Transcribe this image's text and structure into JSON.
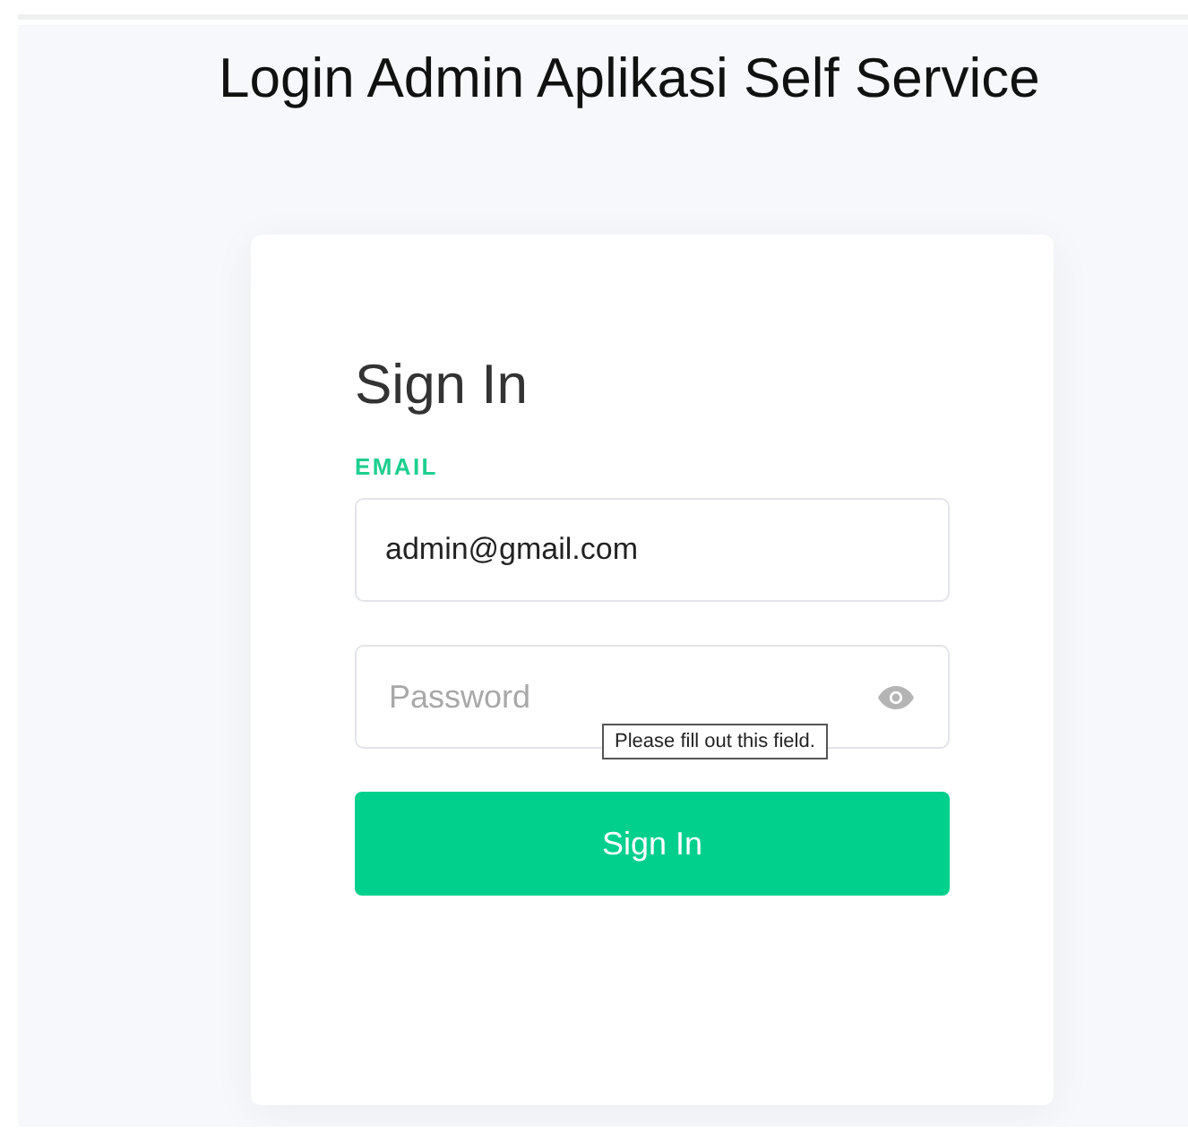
{
  "page_title": "Login Admin Aplikasi Self Service",
  "form": {
    "heading": "Sign In",
    "email": {
      "label": "EMAIL",
      "value": "admin@gmail.com"
    },
    "password": {
      "placeholder": "Password"
    },
    "tooltip": "Please fill out this field.",
    "submit": "Sign In"
  }
}
